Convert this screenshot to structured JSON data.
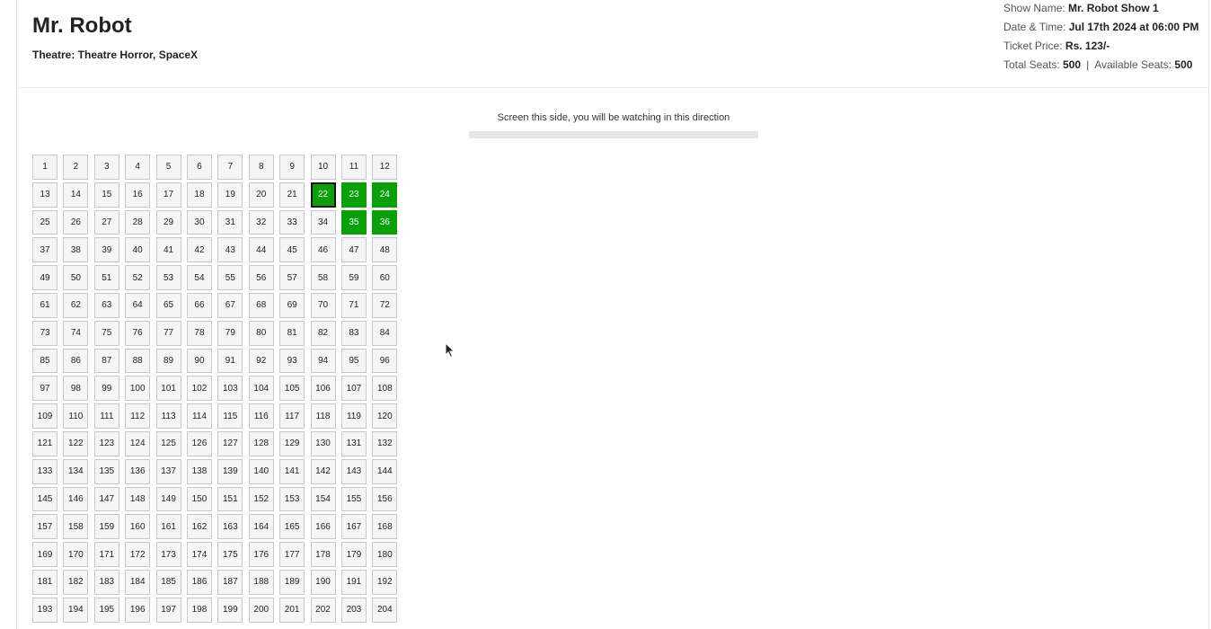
{
  "movie": {
    "title": "Mr. Robot",
    "theatre": "Theatre: Theatre Horror, SpaceX"
  },
  "info": {
    "show_name_label": "Show Name:",
    "show_name_value": "Mr. Robot Show 1",
    "datetime_label": "Date & Time:",
    "datetime_value": "Jul 17th 2024 at 06:00 PM",
    "price_label": "Ticket Price:",
    "price_value": "Rs. 123/-",
    "total_seats_label": "Total Seats:",
    "total_seats_value": "500",
    "separator": "|",
    "available_seats_label": "Available Seats:",
    "available_seats_value": "500"
  },
  "screen": {
    "note": "Screen this side, you will be watching in this direction"
  },
  "seats": {
    "visible_count": 204,
    "selected": [
      22,
      23,
      24,
      35,
      36
    ],
    "focused": 22
  },
  "colors": {
    "selected_seat": "#0aa00a",
    "seat_background": "#f5f5f5"
  }
}
